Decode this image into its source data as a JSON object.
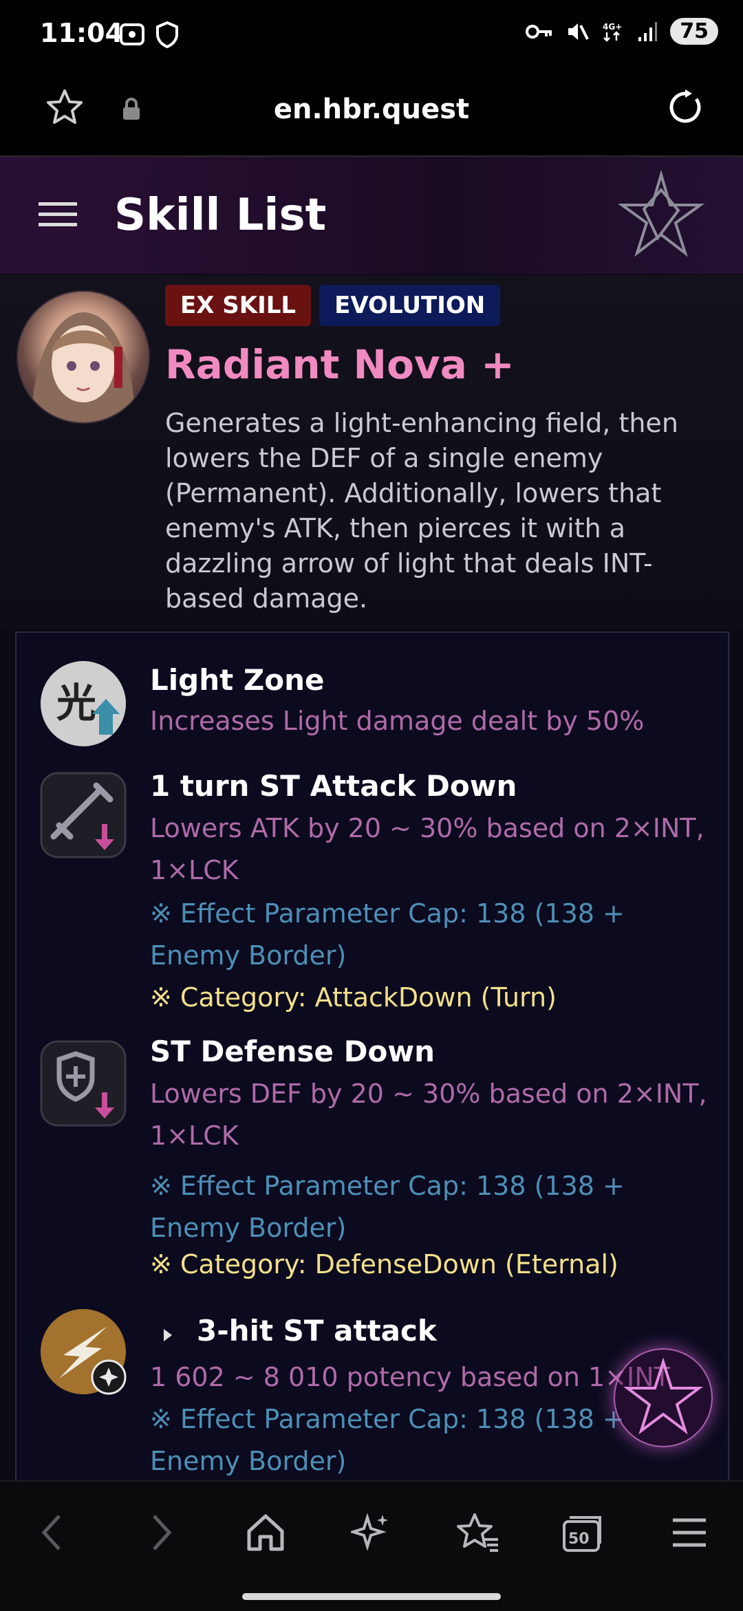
{
  "status_bar": {
    "time": "11:04",
    "battery": "75"
  },
  "browser": {
    "url": "en.hbr.quest"
  },
  "header": {
    "title": "Skill List"
  },
  "skill": {
    "badge_ex": "EX SKILL",
    "badge_evolution": "EVOLUTION",
    "name": "Radiant Nova +",
    "description": "Generates a light-enhancing field, then lowers the DEF of a single enemy (Permanent). Additionally, lowers that enemy's ATK, then pierces it with a dazzling arrow of light that deals INT-based damage."
  },
  "effects": [
    {
      "icon": "light-zone-icon",
      "title": "Light Zone",
      "detail": "Increases Light damage dealt by 50%"
    },
    {
      "icon": "attack-down-icon",
      "title": "1 turn ST Attack Down",
      "detail": "Lowers ATK by 20 ~ 30% based on 2×INT, 1×LCK",
      "cap": "※ Effect Parameter Cap: 138 (138 + Enemy Border)",
      "category": "※ Category: AttackDown (Turn)"
    },
    {
      "icon": "defense-down-icon",
      "title": "ST Defense Down",
      "detail": "Lowers DEF by 20 ~ 30% based on 2×INT, 1×LCK",
      "cap": "※ Effect Parameter Cap: 138 (138 + Enemy Border)",
      "category": "※ Category: DefenseDown (Eternal)"
    },
    {
      "icon": "light-attack-icon",
      "title": "3-hit ST attack",
      "detail": "1 602 ~ 8 010 potency based on 1×INT",
      "cap": "※ Effect Parameter Cap: 138 (138 + Enemy Border)"
    }
  ],
  "colors": {
    "accent_pink": "#f08ac0",
    "ex_badge": "#6a1212",
    "evolution_badge": "#0d1b5a"
  }
}
